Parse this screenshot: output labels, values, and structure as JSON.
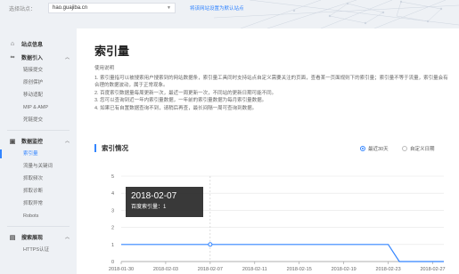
{
  "topbar": {
    "site_label": "选择站点：",
    "site_value": "hao.guajiba.cn",
    "default_link": "将该网站设置为默认站点"
  },
  "sidebar": {
    "groups": [
      {
        "label": "站点信息",
        "icon": "house-icon"
      },
      {
        "label": "数据引入",
        "icon": "link-icon",
        "items": [
          "链接提交",
          "原创保护",
          "移动适配",
          "MIP & AMP",
          "死链提交"
        ]
      },
      {
        "label": "数据监控",
        "icon": "monitor-icon",
        "items": [
          "索引量",
          "流量与关键词",
          "抓取频次",
          "抓取诊断",
          "抓取异常",
          "Robots"
        ]
      },
      {
        "label": "搜索展现",
        "icon": "search-display-icon",
        "items": [
          "HTTPS认证"
        ]
      }
    ]
  },
  "main": {
    "title": "索引量",
    "usage_title": "使用说明",
    "notes": [
      "1. 索引量指可以被搜索用户搜索到的网站数据条，索引量工具同时支持站点自定义需要关注的页面，查看某一页面规则下的索引量；索引量不等于流量，索引量会有合理的数据波动，属于正常现象。",
      "2. 百度索引数据量每周更新一次，最近一周更新一次，不同站的更新日期可能不同。",
      "3. 您可以查询到近一年内索引量数据，一年前的索引量数据为每月索引量数据。",
      "4. 如果已有自置数据查询不到，请稍后再查，最长间隔一周可查询到数据。"
    ]
  },
  "chart_section": {
    "title": "索引情况",
    "range_options": [
      "最近30天",
      "自定义日期"
    ],
    "selected_range": "最近30天"
  },
  "tooltip": {
    "date": "2018-02-07",
    "label": "百度索引量",
    "value": "1"
  },
  "chart_data": {
    "type": "line",
    "title": "",
    "xlabel": "",
    "ylabel": "",
    "ylim": [
      0,
      5
    ],
    "yticks": [
      0,
      1,
      2,
      3,
      4,
      5
    ],
    "xticks": [
      "2018-01-30",
      "2018-02-03",
      "2018-02-07",
      "2018-02-11",
      "2018-02-15",
      "2018-02-19",
      "2018-02-23",
      "2018-02-27"
    ],
    "x": [
      "2018-01-30",
      "2018-01-31",
      "2018-02-01",
      "2018-02-02",
      "2018-02-03",
      "2018-02-04",
      "2018-02-05",
      "2018-02-06",
      "2018-02-07",
      "2018-02-08",
      "2018-02-09",
      "2018-02-10",
      "2018-02-11",
      "2018-02-12",
      "2018-02-13",
      "2018-02-14",
      "2018-02-15",
      "2018-02-16",
      "2018-02-17",
      "2018-02-18",
      "2018-02-19",
      "2018-02-20",
      "2018-02-21",
      "2018-02-22",
      "2018-02-23",
      "2018-02-24",
      "2018-02-25",
      "2018-02-26",
      "2018-02-27",
      "2018-02-28"
    ],
    "series": [
      {
        "values": [
          1,
          1,
          1,
          1,
          1,
          1,
          1,
          1,
          1,
          1,
          1,
          1,
          1,
          1,
          1,
          1,
          1,
          1,
          1,
          1,
          1,
          1,
          1,
          1,
          1,
          0,
          0,
          0,
          0,
          0
        ]
      }
    ],
    "grid": true,
    "colors": {
      "line": "#3385ff",
      "grid": "#e6e6e6",
      "axis": "#999999"
    }
  }
}
